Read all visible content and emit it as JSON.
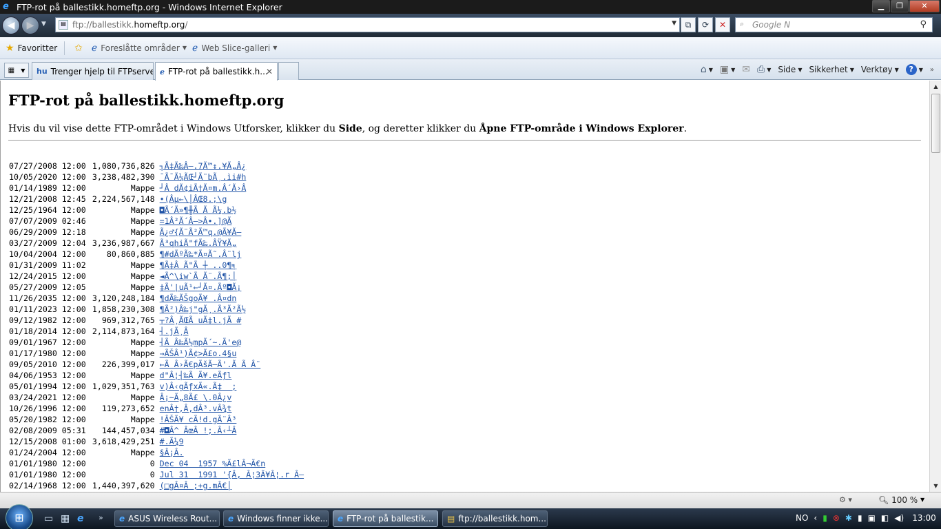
{
  "window": {
    "title": "FTP-rot på ballestikk.homeftp.org - Windows Internet Explorer",
    "min": "▁",
    "max": "❐",
    "close": "✕"
  },
  "address": {
    "url_prefix": "ftp://ballestikk.",
    "url_host": "homeftp.org",
    "url_suffix": "/",
    "search_placeholder": "Google N"
  },
  "favorites": {
    "favorites_label": "Favoritter",
    "suggested_label": "Foreslåtte områder",
    "webslice_label": "Web Slice-galleri"
  },
  "tabs": [
    {
      "label": "Trenger hjelp til FTPserver ..."
    },
    {
      "label": "FTP-rot på ballestikk.h..."
    }
  ],
  "commandbar": {
    "page": "Side",
    "safety": "Sikkerhet",
    "tools": "Verktøy"
  },
  "page": {
    "heading": "FTP-rot på ballestikk.homeftp.org",
    "intro_pre": "Hvis du vil vise dette FTP-området i Windows Utforsker, klikker du ",
    "intro_b1": "Side",
    "intro_mid": ", og deretter klikker du ",
    "intro_b2": "Åpne FTP-område i Windows Explorer",
    "intro_post": "."
  },
  "listing": [
    {
      "date": "07/27/2008 12:00",
      "size": "1,080,736,826",
      "name": "┐Ã‡Ã‰Â–.7Ã™↕.¥Ã„Â¿"
    },
    {
      "date": "10/05/2020 12:00",
      "size": "3,238,482,390",
      "name": "¯Ã¯Ã¼ÃŒ┘Ã¨bÃ¸.ìi#h"
    },
    {
      "date": "01/14/1989 12:00",
      "size": "Mappe",
      "name": "┘Â dÃ¢iÃ†Ã¤m.Â´Ã›Â"
    },
    {
      "date": "12/21/2008 12:45",
      "size": "2,224,567,148",
      "name": "•(Âµ←\\│ÂŒ8.;\\g"
    },
    {
      "date": "12/25/1964 12:00",
      "size": "Mappe",
      "name": "◘Ã´Ã»¶╫Ã Ã Ã¼.b½"
    },
    {
      "date": "07/07/2009 02:46",
      "size": "Mappe",
      "name": "=1Â²Ã´Â–>Â•.]@Ã"
    },
    {
      "date": "06/29/2009 12:18",
      "size": "Mappe",
      "name": "Ã¿♂{Ã¨Ã²Ã™q.@Ã¥Ã–"
    },
    {
      "date": "03/27/2009 12:04",
      "size": "3,236,987,667",
      "name": "Ã³qhiÃ\"fÃ‰.ÂŸ¥Ã„"
    },
    {
      "date": "10/04/2004 12:00",
      "size": "80,860,885",
      "name": "¶#dÃºÃ‰*Ã¤Ã˜.Â¨lj"
    },
    {
      "date": "01/31/2009 11:02",
      "size": "Mappe",
      "name": "¶Ã‡Â Ã\"Ã ┼ ..0¶╕"
    },
    {
      "date": "12/24/2015 12:00",
      "size": "Mappe",
      "name": "◄Ã^\\iw`Ã Ã¨.Ã¶;│"
    },
    {
      "date": "05/27/2009 12:05",
      "size": "Mappe",
      "name": "‡Ã'|uÃ¹←┘Ã¤.Ãº◘Ã¡"
    },
    {
      "date": "11/26/2035 12:00",
      "size": "3,120,248,184",
      "name": "¶dÃ‰ÃŠgoÃ¥ .Â¤dn"
    },
    {
      "date": "01/11/2023 12:00",
      "size": "1,858,230,308",
      "name": "¶Ã²)Â‰j\"gÃ¸.Ã³Ã²Ã½"
    },
    {
      "date": "09/12/1982 12:00",
      "size": "969,312,765",
      "name": "┬?Â¸ÃŒÃ uÃ‡l.jÃ #"
    },
    {
      "date": "01/18/2014 12:00",
      "size": "2,114,873,164",
      "name": "┤.jÃ¸Â"
    },
    {
      "date": "09/01/1967 12:00",
      "size": "Mappe",
      "name": "┤Ã Â‰Ã½mpÃ´~.Ã'e@"
    },
    {
      "date": "01/17/1980 12:00",
      "size": "Mappe",
      "name": "→ÃŠÂ¹)Ã¢>Ã£o.4§u"
    },
    {
      "date": "09/05/2010 12:00",
      "size": "226,399,017",
      "name": "←Ã Â›Ã€pÃšÃ–Ã'.Ã Ã Â¨"
    },
    {
      "date": "04/06/1953 12:00",
      "size": "Mappe",
      "name": "d\"Â¦┤‰Ã Ã¥.eÃƒl"
    },
    {
      "date": "05/01/1994 12:00",
      "size": "1,029,351,763",
      "name": "v)Â‹gÃƒxÃ«.Ã‡  ;"
    },
    {
      "date": "03/24/2021 12:00",
      "size": "Mappe",
      "name": "Â¡~Ã„8Ã£ \\.0Â¿v"
    },
    {
      "date": "10/26/1996 12:00",
      "size": "119,273,652",
      "name": "enÂ†,Â,dÂ³.vÂ¾t"
    },
    {
      "date": "05/20/1982 12:00",
      "size": "Mappe",
      "name": "!ÂŠÃ¥ cÃ!d.gÃ¨Â³"
    },
    {
      "date": "02/08/2009 05:31",
      "size": "144,457,034",
      "name": "#◘Â^ ÂœÂ !;.Â‹┴Â"
    },
    {
      "date": "12/15/2008 01:00",
      "size": "3,618,429,251",
      "name": "#.Ã¼9"
    },
    {
      "date": "01/24/2004 12:00",
      "size": "Mappe",
      "name": "§Â¡Â."
    },
    {
      "date": "01/01/1980 12:00",
      "size": "0",
      "name": "Dec 04  1957 %Ã£lÂ¬Ã€n"
    },
    {
      "date": "01/01/1980 12:00",
      "size": "0",
      "name": "Jul 31  1991 '{Â, Â¦3Ã¥Â¦.r Â–"
    },
    {
      "date": "02/14/1968 12:00",
      "size": "1,440,397,620",
      "name": "(□gÂ¤Â ;+g.mÂ€│"
    }
  ],
  "status": {
    "zoom": "100 %"
  },
  "taskbar": {
    "tasks": [
      {
        "label": "ASUS Wireless Rout..."
      },
      {
        "label": "Windows finner ikke..."
      },
      {
        "label": "FTP-rot på ballestik..."
      },
      {
        "label": "ftp://ballestikk.hom..."
      }
    ],
    "lang": "NO",
    "clock": "13:00"
  }
}
